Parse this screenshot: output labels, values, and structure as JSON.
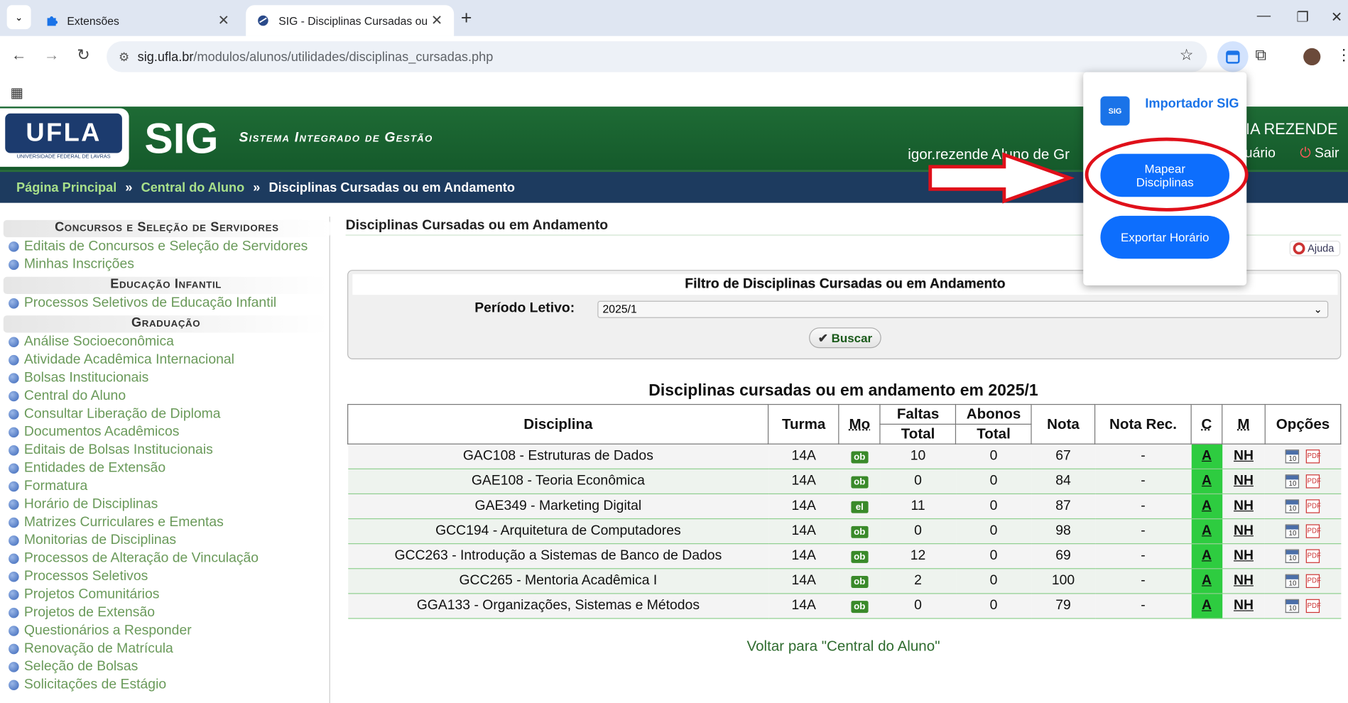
{
  "browser": {
    "tabs": [
      {
        "title": "Extensões",
        "active": false
      },
      {
        "title": "SIG - Disciplinas Cursadas ou em Andamento",
        "active": true
      }
    ],
    "url_host": "sig.ufla.br",
    "url_path": "/modulos/alunos/utilidades/disciplinas_cursadas.php"
  },
  "header": {
    "logo_text": "UFLA",
    "logo_sub": "UNIVERSIDADE FEDERAL DE LAVRAS",
    "app_name": "SIG",
    "app_subtitle": "Sistema Integrado de Gestão",
    "user_name_fragment": "CIA REZENDE",
    "user_login_line": "igor.rezende   Aluno de Gr",
    "user_menu_fragment": "suário",
    "logout": "Sair"
  },
  "breadcrumb": {
    "home": "Página Principal",
    "sep": "»",
    "parent": "Central do Aluno",
    "current": "Disciplinas Cursadas ou em Andamento"
  },
  "sidebar": {
    "sections": [
      {
        "title": "Concursos e Seleção de Servidores",
        "items": [
          "Editais de Concursos e Seleção de Servidores",
          "Minhas Inscrições"
        ]
      },
      {
        "title": "Educação Infantil",
        "items": [
          "Processos Seletivos de Educação Infantil"
        ]
      },
      {
        "title": "Graduação",
        "items": [
          "Análise Socioeconômica",
          "Atividade Acadêmica Internacional",
          "Bolsas Institucionais",
          "Central do Aluno",
          "Consultar Liberação de Diploma",
          "Documentos Acadêmicos",
          "Editais de Bolsas Institucionais",
          "Entidades de Extensão",
          "Formatura",
          "Horário de Disciplinas",
          "Matrizes Curriculares e Ementas",
          "Monitorias de Disciplinas",
          "Processos de Alteração de Vinculação",
          "Processos Seletivos",
          "Projetos Comunitários",
          "Projetos de Extensão",
          "Questionários a Responder",
          "Renovação de Matrícula",
          "Seleção de Bolsas",
          "Solicitações de Estágio"
        ]
      }
    ]
  },
  "main": {
    "title": "Disciplinas Cursadas ou em Andamento",
    "help": "Ajuda",
    "filter": {
      "title": "Filtro de Disciplinas Cursadas ou em Andamento",
      "period_label": "Período Letivo:",
      "period_value": "2025/1",
      "search_button": "Buscar"
    },
    "table_caption": "Disciplinas cursadas ou em andamento em 2025/1",
    "headers": {
      "disciplina": "Disciplina",
      "turma": "Turma",
      "mo": "Mo",
      "faltas": "Faltas",
      "faltas_sub": "Total",
      "abonos": "Abonos",
      "abonos_sub": "Total",
      "nota": "Nota",
      "nota_rec": "Nota Rec.",
      "c": "C",
      "m": "M",
      "opcoes": "Opções"
    },
    "rows": [
      {
        "disciplina": "GAC108 - Estruturas de Dados",
        "turma": "14A",
        "mo": "ob",
        "faltas": "10",
        "abonos": "0",
        "nota": "67",
        "nota_rec": "-",
        "c": "A",
        "m": "NH"
      },
      {
        "disciplina": "GAE108 - Teoria Econômica",
        "turma": "14A",
        "mo": "ob",
        "faltas": "0",
        "abonos": "0",
        "nota": "84",
        "nota_rec": "-",
        "c": "A",
        "m": "NH"
      },
      {
        "disciplina": "GAE349 - Marketing Digital",
        "turma": "14A",
        "mo": "el",
        "faltas": "11",
        "abonos": "0",
        "nota": "87",
        "nota_rec": "-",
        "c": "A",
        "m": "NH"
      },
      {
        "disciplina": "GCC194 - Arquitetura de Computadores",
        "turma": "14A",
        "mo": "ob",
        "faltas": "0",
        "abonos": "0",
        "nota": "98",
        "nota_rec": "-",
        "c": "A",
        "m": "NH"
      },
      {
        "disciplina": "GCC263 - Introdução a Sistemas de Banco de Dados",
        "turma": "14A",
        "mo": "ob",
        "faltas": "12",
        "abonos": "0",
        "nota": "69",
        "nota_rec": "-",
        "c": "A",
        "m": "NH"
      },
      {
        "disciplina": "GCC265 - Mentoria Acadêmica I",
        "turma": "14A",
        "mo": "ob",
        "faltas": "2",
        "abonos": "0",
        "nota": "100",
        "nota_rec": "-",
        "c": "A",
        "m": "NH"
      },
      {
        "disciplina": "GGA133 - Organizações, Sistemas e Métodos",
        "turma": "14A",
        "mo": "ob",
        "faltas": "0",
        "abonos": "0",
        "nota": "79",
        "nota_rec": "-",
        "c": "A",
        "m": "NH"
      }
    ],
    "back_link": "Voltar para \"Central do Aluno\""
  },
  "extension_popup": {
    "icon_text": "SIG",
    "title": "Importador SIG",
    "button_map": "Mapear Disciplinas",
    "button_export": "Exportar Horário"
  },
  "icons": {
    "calendar_text": "10",
    "pdf_text": "PDF"
  },
  "colors": {
    "header_green": "#1e6b35",
    "breadcrumb_navy": "#1d3b5f",
    "status_green": "#2ecc40",
    "popup_blue": "#0d6efd",
    "highlight_red": "#e0101a"
  }
}
